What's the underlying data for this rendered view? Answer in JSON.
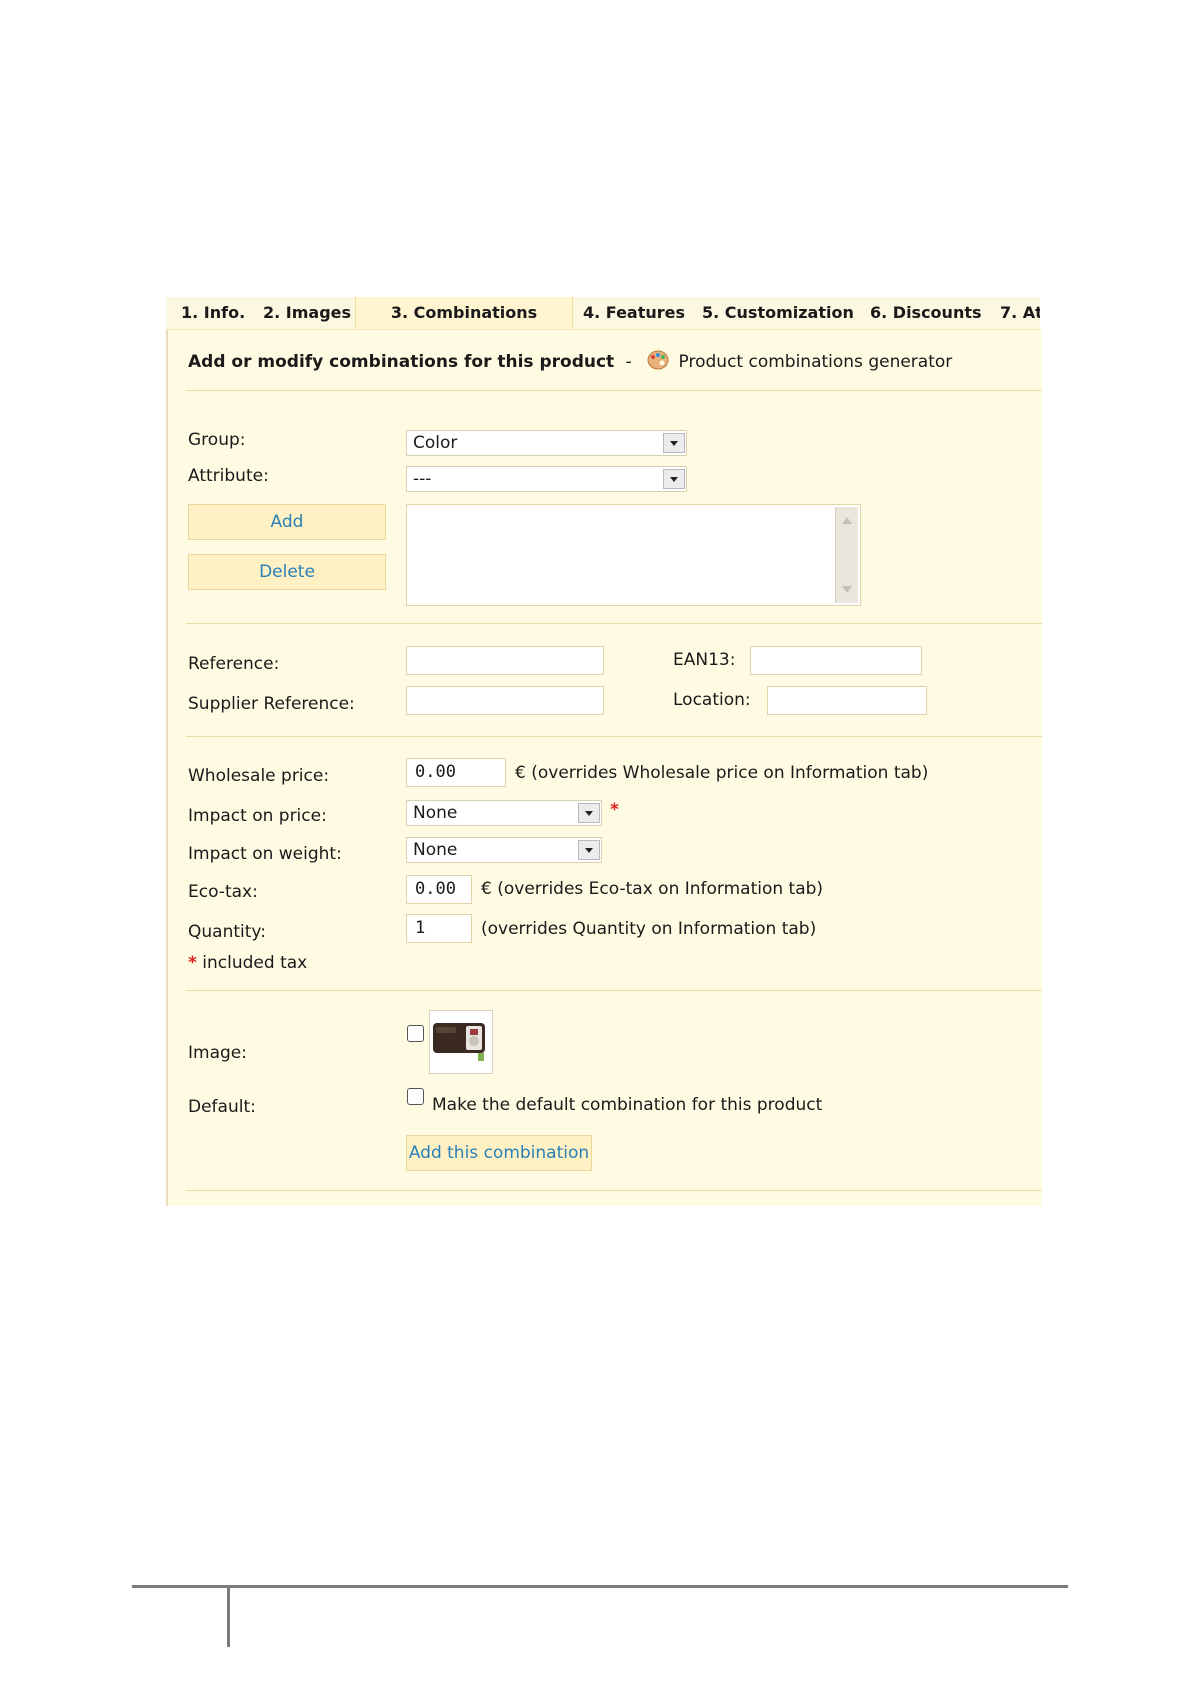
{
  "tabs": [
    {
      "label": "1. Info."
    },
    {
      "label": "2. Images"
    },
    {
      "label": "3. Combinations"
    },
    {
      "label": "4. Features"
    },
    {
      "label": "5. Customization"
    },
    {
      "label": "6. Discounts"
    },
    {
      "label": "7. At"
    }
  ],
  "header": {
    "title": "Add or modify combinations for this product",
    "separator": "-",
    "generator_link": "Product combinations generator",
    "generator_icon": "palette-icon"
  },
  "attributes": {
    "group_label": "Group:",
    "group_value": "Color",
    "attribute_label": "Attribute:",
    "attribute_value": "---",
    "add_button": "Add",
    "delete_button": "Delete"
  },
  "references": {
    "reference_label": "Reference:",
    "reference_value": "",
    "ean13_label": "EAN13:",
    "ean13_value": "",
    "supplier_reference_label": "Supplier Reference:",
    "supplier_reference_value": "",
    "location_label": "Location:",
    "location_value": ""
  },
  "pricing": {
    "wholesale_label": "Wholesale price:",
    "wholesale_value": "0.00",
    "wholesale_note": "€ (overrides Wholesale price on Information tab)",
    "impact_price_label": "Impact on price:",
    "impact_price_value": "None",
    "impact_weight_label": "Impact on weight:",
    "impact_weight_value": "None",
    "ecotax_label": "Eco-tax:",
    "ecotax_value": "0.00",
    "ecotax_note": "€ (overrides Eco-tax on Information tab)",
    "quantity_label": "Quantity:",
    "quantity_value": "1",
    "quantity_note": "(overrides Quantity on Information tab)",
    "asterisk": "*",
    "included_tax": "included tax"
  },
  "image_section": {
    "image_label": "Image:",
    "default_label": "Default:",
    "default_checkbox_text": "Make the default combination for this product",
    "submit_button": "Add this combination"
  },
  "colors": {
    "panel_bg": "#fffbe3",
    "button_bg": "#fff1c4",
    "link_blue": "#2a7fb6",
    "required_red": "#e02020"
  }
}
